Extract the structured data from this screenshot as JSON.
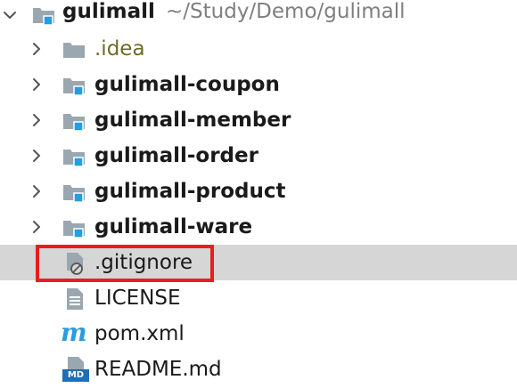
{
  "project": {
    "name": "gulimall",
    "path": "~/Study/Demo/gulimall",
    "items": [
      {
        "label": ".idea",
        "kind": "folder-plain",
        "expandable": true
      },
      {
        "label": "gulimall-coupon",
        "kind": "module",
        "expandable": true
      },
      {
        "label": "gulimall-member",
        "kind": "module",
        "expandable": true
      },
      {
        "label": "gulimall-order",
        "kind": "module",
        "expandable": true
      },
      {
        "label": "gulimall-product",
        "kind": "module",
        "expandable": true
      },
      {
        "label": "gulimall-ware",
        "kind": "module",
        "expandable": true
      },
      {
        "label": ".gitignore",
        "kind": "ignored-file",
        "expandable": false,
        "selected": true
      },
      {
        "label": "LICENSE",
        "kind": "text-file",
        "expandable": false
      },
      {
        "label": "pom.xml",
        "kind": "maven-file",
        "expandable": false
      },
      {
        "label": "README.md",
        "kind": "markdown-file",
        "expandable": false
      }
    ]
  },
  "icons": {
    "md_badge": "MD",
    "maven_glyph": "m"
  },
  "colors": {
    "selection": "#d6d6d6",
    "highlight": "#e81d23",
    "folder": "#9aa7b0",
    "module_badge": "#1f9fe6",
    "idea_text": "#6b6b28",
    "path_text": "#7f7f7f",
    "maven": "#2b9be0"
  }
}
